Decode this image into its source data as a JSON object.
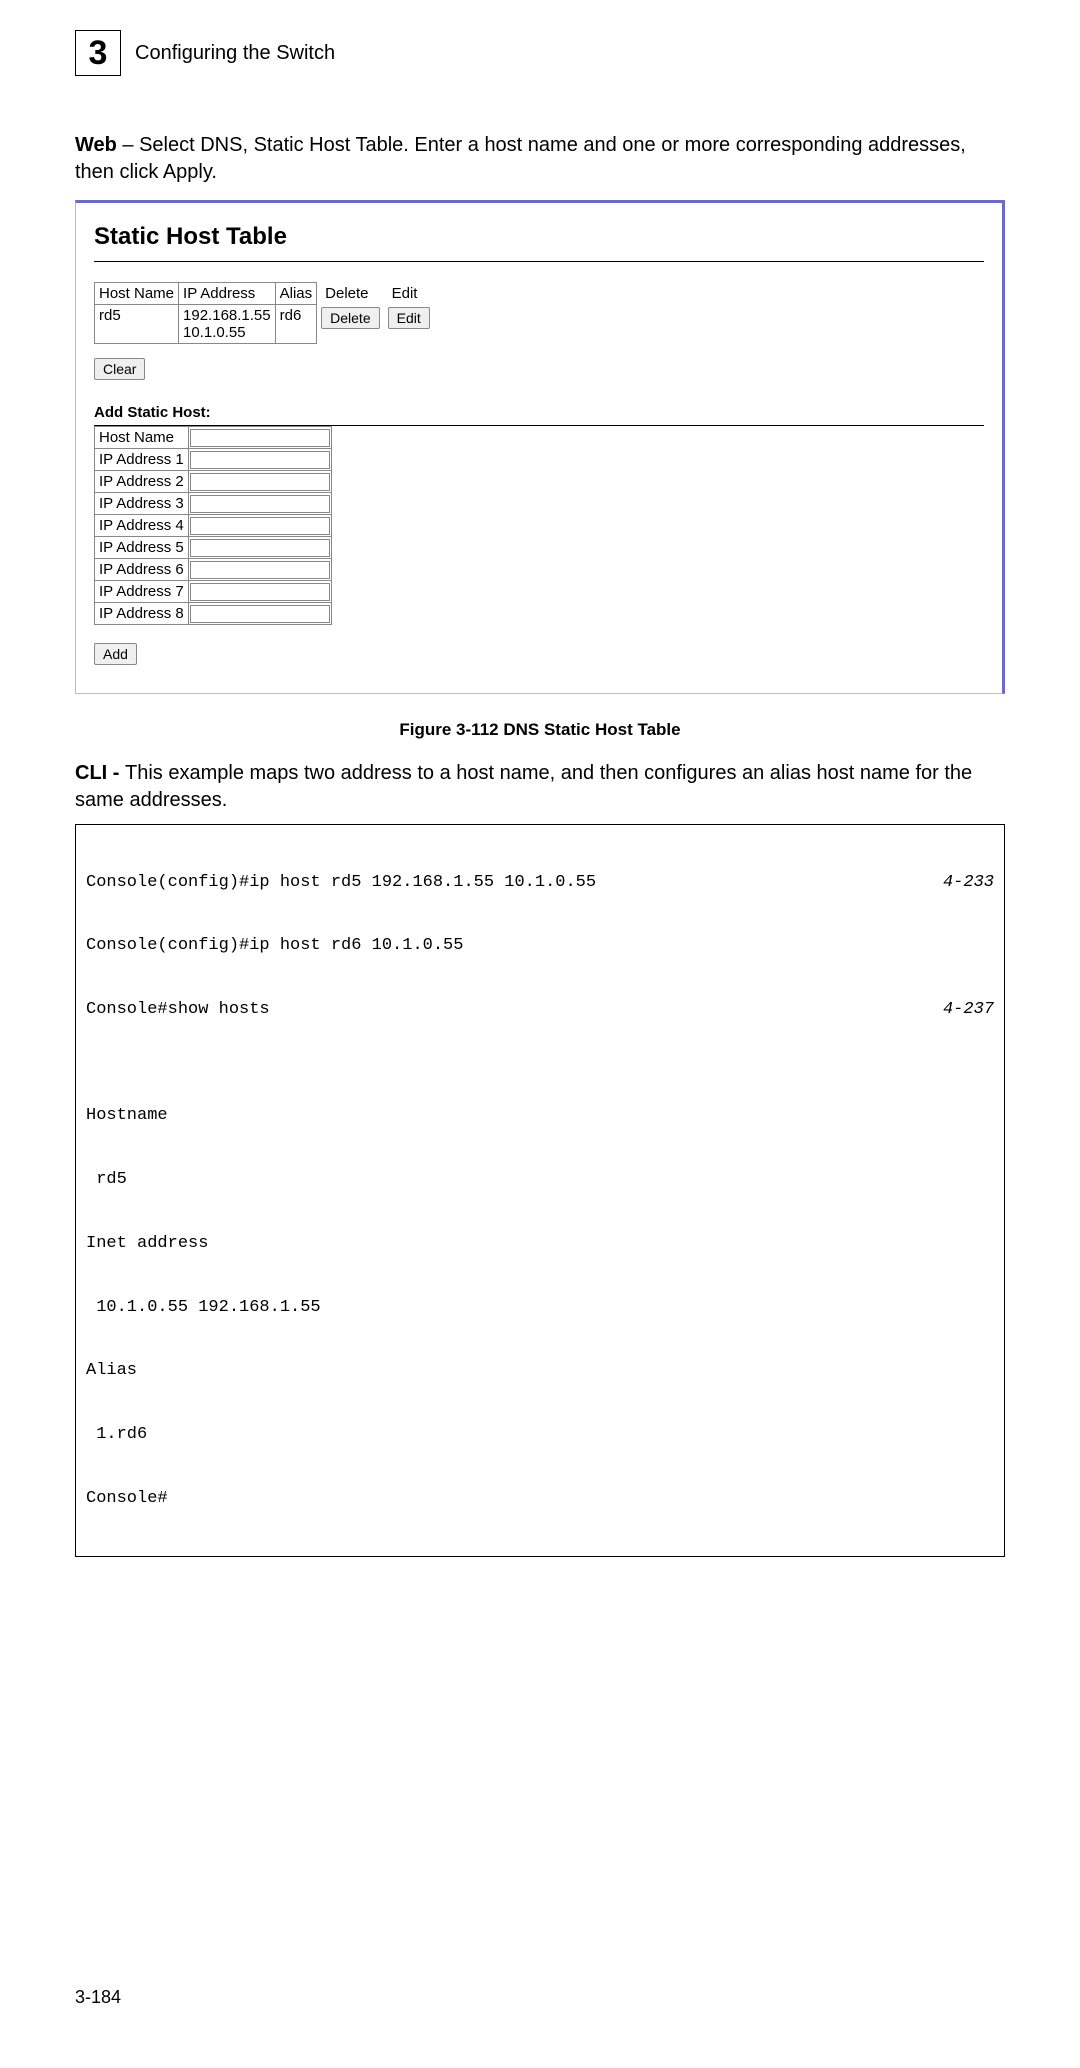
{
  "header": {
    "chapter_number": "3",
    "chapter_title": "Configuring the Switch"
  },
  "intro": {
    "label": "Web",
    "text": " – Select DNS, Static Host Table. Enter a host name and one or more corresponding addresses, then click Apply."
  },
  "figure": {
    "title": "Static Host Table",
    "host_table": {
      "headers": [
        "Host Name",
        "IP Address",
        "Alias",
        "Delete",
        "Edit"
      ],
      "row": {
        "host_name": "rd5",
        "ip": "192.168.1.55\n10.1.0.55",
        "alias": "rd6",
        "delete_btn": "Delete",
        "edit_btn": "Edit"
      }
    },
    "clear_btn": "Clear",
    "add_section": {
      "title": "Add Static Host:",
      "fields": [
        "Host Name",
        "IP Address 1",
        "IP Address 2",
        "IP Address 3",
        "IP Address 4",
        "IP Address 5",
        "IP Address 6",
        "IP Address 7",
        "IP Address 8"
      ],
      "add_btn": "Add"
    },
    "caption": "Figure 3-112  DNS Static Host Table"
  },
  "cli_intro": {
    "label": "CLI - ",
    "text": "This example maps two address to a host name, and then configures an alias host name for the same addresses."
  },
  "cli": {
    "lines": [
      {
        "left": "Console(config)#ip host rd5 192.168.1.55 10.1.0.55",
        "right": "4-233"
      },
      {
        "left": "Console(config)#ip host rd6 10.1.0.55",
        "right": ""
      },
      {
        "left": "Console#show hosts",
        "right": "4-237"
      },
      {
        "left": "",
        "right": ""
      },
      {
        "left": "Hostname",
        "right": ""
      },
      {
        "left": " rd5",
        "right": ""
      },
      {
        "left": "Inet address",
        "right": ""
      },
      {
        "left": " 10.1.0.55 192.168.1.55",
        "right": ""
      },
      {
        "left": "Alias",
        "right": ""
      },
      {
        "left": " 1.rd6",
        "right": ""
      },
      {
        "left": "Console#",
        "right": ""
      }
    ]
  },
  "page_number": "3-184"
}
